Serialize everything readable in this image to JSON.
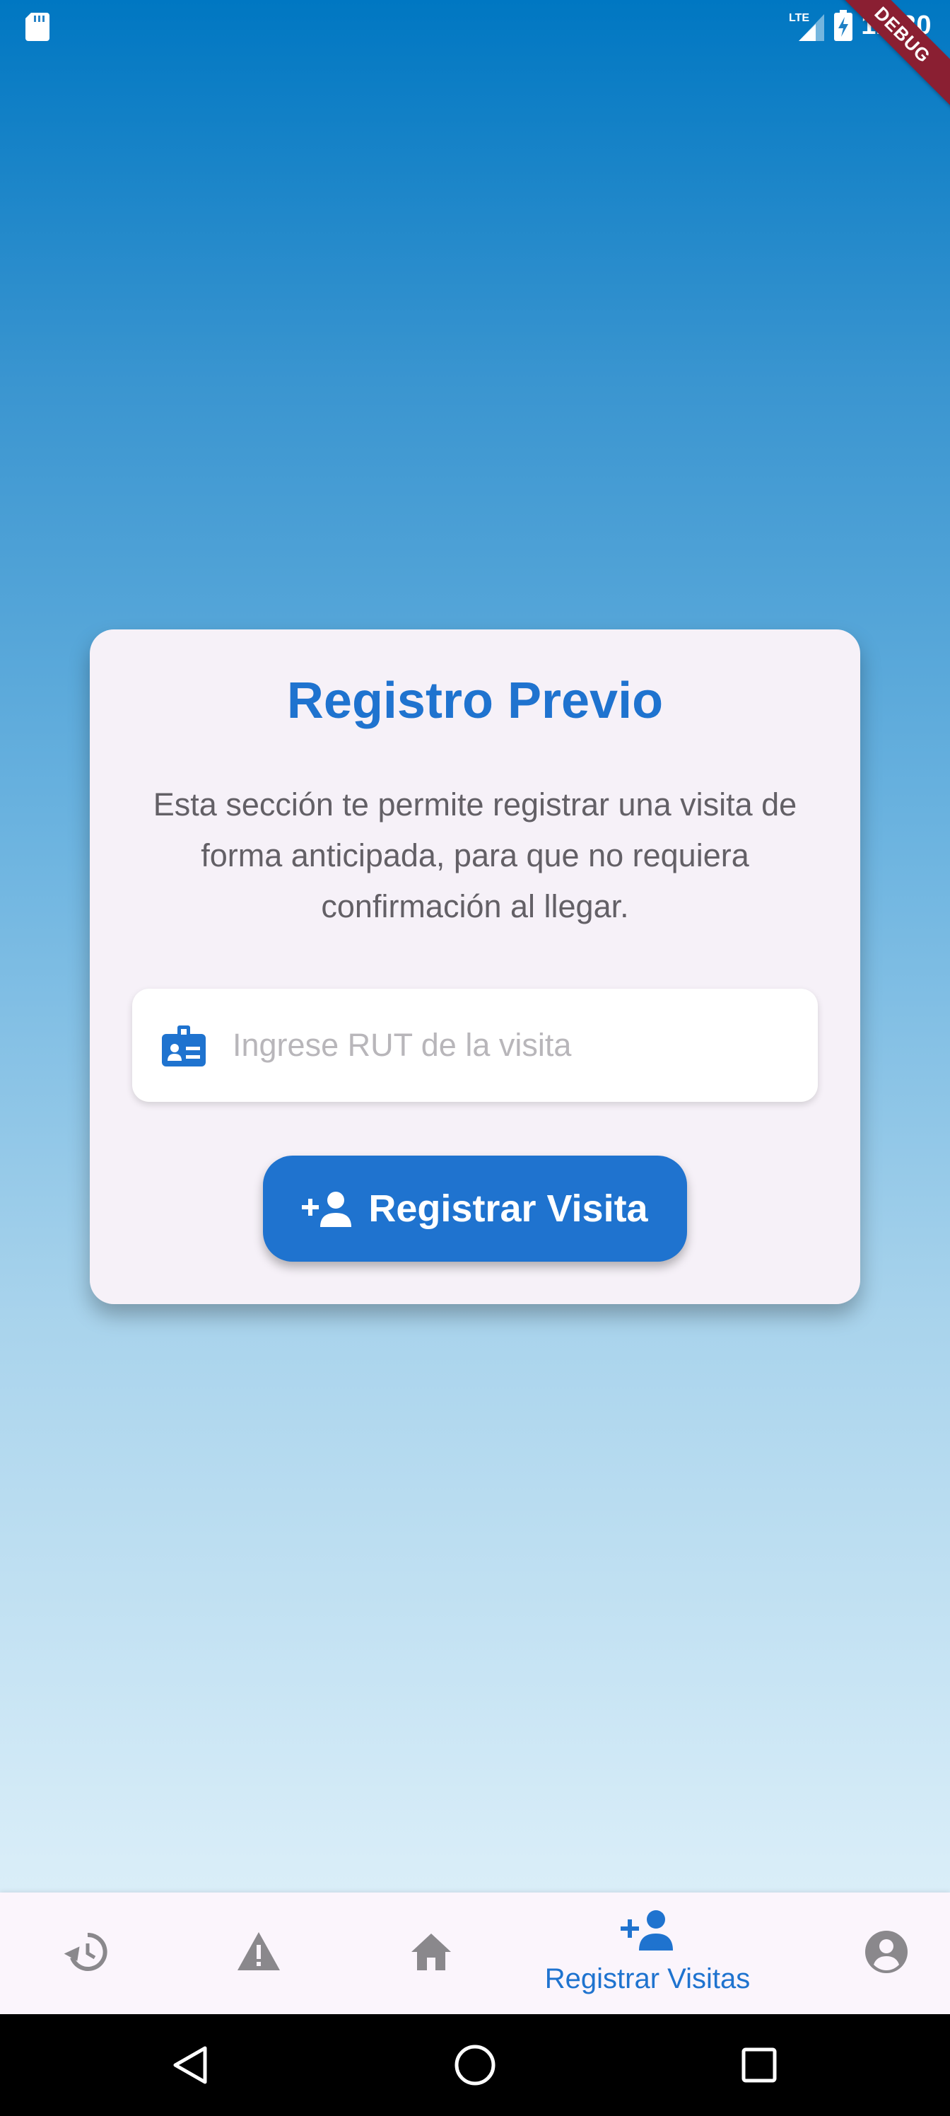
{
  "status_bar": {
    "time": "12:30",
    "network": "LTE",
    "debug_banner": "DEBUG"
  },
  "card": {
    "title": "Registro Previo",
    "description": "Esta sección te permite registrar una visita de forma anticipada, para que no requiera confirmación al llegar.",
    "rut_input": {
      "placeholder": "Ingrese RUT de la visita",
      "value": ""
    },
    "register_button": "Registrar Visita"
  },
  "bottom_nav": {
    "items": [
      {
        "icon": "history-icon",
        "label": ""
      },
      {
        "icon": "warning-icon",
        "label": ""
      },
      {
        "icon": "home-icon",
        "label": ""
      },
      {
        "icon": "person-add-icon",
        "label": "Registrar Visitas",
        "active": true
      },
      {
        "icon": "account-circle-icon",
        "label": ""
      }
    ]
  },
  "colors": {
    "accent": "#1f73cf",
    "card_background": "#f6f1f8",
    "nav_icon_inactive": "#8a888c",
    "debug_ribbon": "#8a1f32"
  }
}
